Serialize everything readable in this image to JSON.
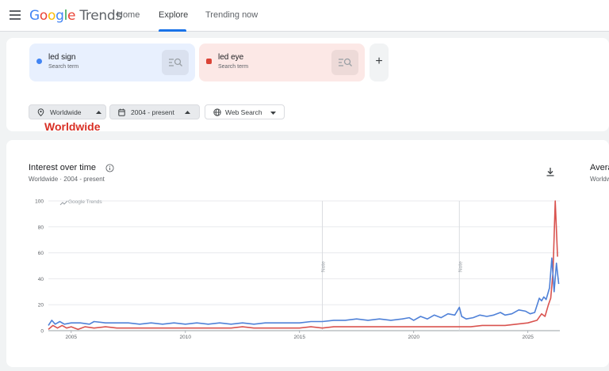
{
  "header": {
    "logo_google": "Google",
    "logo_trends": "Trends",
    "nav": [
      "Home",
      "Explore",
      "Trending now"
    ],
    "active_nav": "Explore"
  },
  "terms": [
    {
      "name": "led sign",
      "sub": "Search term",
      "color": "#4285f4"
    },
    {
      "name": "led eye",
      "sub": "Search term",
      "color": "#db4437"
    }
  ],
  "filters": {
    "region": "Worldwide",
    "time": "2004 - present",
    "property": "Web Search"
  },
  "annotation": "Worldwide",
  "chart_panel": {
    "title": "Interest over time",
    "subtitle": "Worldwide · 2004 - present",
    "side_title": "Avera",
    "side_sub": "Worldw"
  },
  "chart_data": {
    "type": "line",
    "watermark": "Google Trends",
    "yticks": [
      0,
      20,
      40,
      60,
      80,
      100
    ],
    "ylim": [
      0,
      100
    ],
    "xticks": [
      2005,
      2010,
      2015,
      2020,
      2025
    ],
    "xlim": [
      2004,
      2026.4
    ],
    "notes": [
      {
        "x": 2016.0,
        "label": "Note"
      },
      {
        "x": 2022.0,
        "label": "Note"
      }
    ],
    "series": [
      {
        "name": "led sign",
        "color": "#4f81d8",
        "points": [
          [
            2004.0,
            4
          ],
          [
            2004.15,
            8
          ],
          [
            2004.3,
            5
          ],
          [
            2004.5,
            7
          ],
          [
            2004.7,
            5
          ],
          [
            2005.0,
            6
          ],
          [
            2005.4,
            6
          ],
          [
            2005.8,
            5
          ],
          [
            2006.0,
            7
          ],
          [
            2006.5,
            6
          ],
          [
            2007.0,
            6
          ],
          [
            2007.5,
            6
          ],
          [
            2008.0,
            5
          ],
          [
            2008.5,
            6
          ],
          [
            2009.0,
            5
          ],
          [
            2009.5,
            6
          ],
          [
            2010.0,
            5
          ],
          [
            2010.5,
            6
          ],
          [
            2011.0,
            5
          ],
          [
            2011.5,
            6
          ],
          [
            2012.0,
            5
          ],
          [
            2012.5,
            6
          ],
          [
            2013.0,
            5
          ],
          [
            2013.5,
            6
          ],
          [
            2014.0,
            6
          ],
          [
            2014.5,
            6
          ],
          [
            2015.0,
            6
          ],
          [
            2015.5,
            7
          ],
          [
            2016.0,
            7
          ],
          [
            2016.5,
            8
          ],
          [
            2017.0,
            8
          ],
          [
            2017.5,
            9
          ],
          [
            2018.0,
            8
          ],
          [
            2018.5,
            9
          ],
          [
            2019.0,
            8
          ],
          [
            2019.5,
            9
          ],
          [
            2019.8,
            10
          ],
          [
            2020.0,
            8
          ],
          [
            2020.3,
            11
          ],
          [
            2020.6,
            9
          ],
          [
            2020.9,
            12
          ],
          [
            2021.2,
            10
          ],
          [
            2021.5,
            13
          ],
          [
            2021.8,
            12
          ],
          [
            2022.0,
            18
          ],
          [
            2022.1,
            11
          ],
          [
            2022.3,
            9
          ],
          [
            2022.6,
            10
          ],
          [
            2022.9,
            12
          ],
          [
            2023.2,
            11
          ],
          [
            2023.5,
            12
          ],
          [
            2023.8,
            14
          ],
          [
            2024.0,
            12
          ],
          [
            2024.3,
            13
          ],
          [
            2024.6,
            16
          ],
          [
            2024.9,
            15
          ],
          [
            2025.1,
            13
          ],
          [
            2025.3,
            14
          ],
          [
            2025.5,
            25
          ],
          [
            2025.6,
            23
          ],
          [
            2025.7,
            26
          ],
          [
            2025.8,
            24
          ],
          [
            2025.95,
            33
          ],
          [
            2026.05,
            56
          ],
          [
            2026.15,
            30
          ],
          [
            2026.25,
            52
          ],
          [
            2026.35,
            36
          ]
        ]
      },
      {
        "name": "led eye",
        "color": "#d9534f",
        "points": [
          [
            2004.0,
            1
          ],
          [
            2004.2,
            4
          ],
          [
            2004.4,
            2
          ],
          [
            2004.6,
            4
          ],
          [
            2004.8,
            2
          ],
          [
            2005.0,
            3
          ],
          [
            2005.3,
            1
          ],
          [
            2005.6,
            3
          ],
          [
            2006.0,
            2
          ],
          [
            2006.5,
            3
          ],
          [
            2007.0,
            2
          ],
          [
            2007.5,
            2
          ],
          [
            2008.0,
            2
          ],
          [
            2008.5,
            2
          ],
          [
            2009.0,
            2
          ],
          [
            2009.5,
            2
          ],
          [
            2010.0,
            2
          ],
          [
            2010.5,
            2
          ],
          [
            2011.0,
            2
          ],
          [
            2011.5,
            2
          ],
          [
            2012.0,
            2
          ],
          [
            2012.5,
            3
          ],
          [
            2013.0,
            2
          ],
          [
            2013.5,
            2
          ],
          [
            2014.0,
            2
          ],
          [
            2014.5,
            2
          ],
          [
            2015.0,
            2
          ],
          [
            2015.5,
            3
          ],
          [
            2016.0,
            2
          ],
          [
            2016.5,
            3
          ],
          [
            2017.0,
            3
          ],
          [
            2017.5,
            3
          ],
          [
            2018.0,
            3
          ],
          [
            2018.5,
            3
          ],
          [
            2019.0,
            3
          ],
          [
            2019.5,
            3
          ],
          [
            2020.0,
            3
          ],
          [
            2020.5,
            3
          ],
          [
            2021.0,
            3
          ],
          [
            2021.5,
            3
          ],
          [
            2022.0,
            3
          ],
          [
            2022.5,
            3
          ],
          [
            2023.0,
            4
          ],
          [
            2023.5,
            4
          ],
          [
            2024.0,
            4
          ],
          [
            2024.5,
            5
          ],
          [
            2025.0,
            6
          ],
          [
            2025.4,
            8
          ],
          [
            2025.6,
            13
          ],
          [
            2025.75,
            11
          ],
          [
            2025.9,
            20
          ],
          [
            2026.0,
            25
          ],
          [
            2026.1,
            45
          ],
          [
            2026.2,
            100
          ],
          [
            2026.3,
            57
          ]
        ]
      }
    ]
  }
}
